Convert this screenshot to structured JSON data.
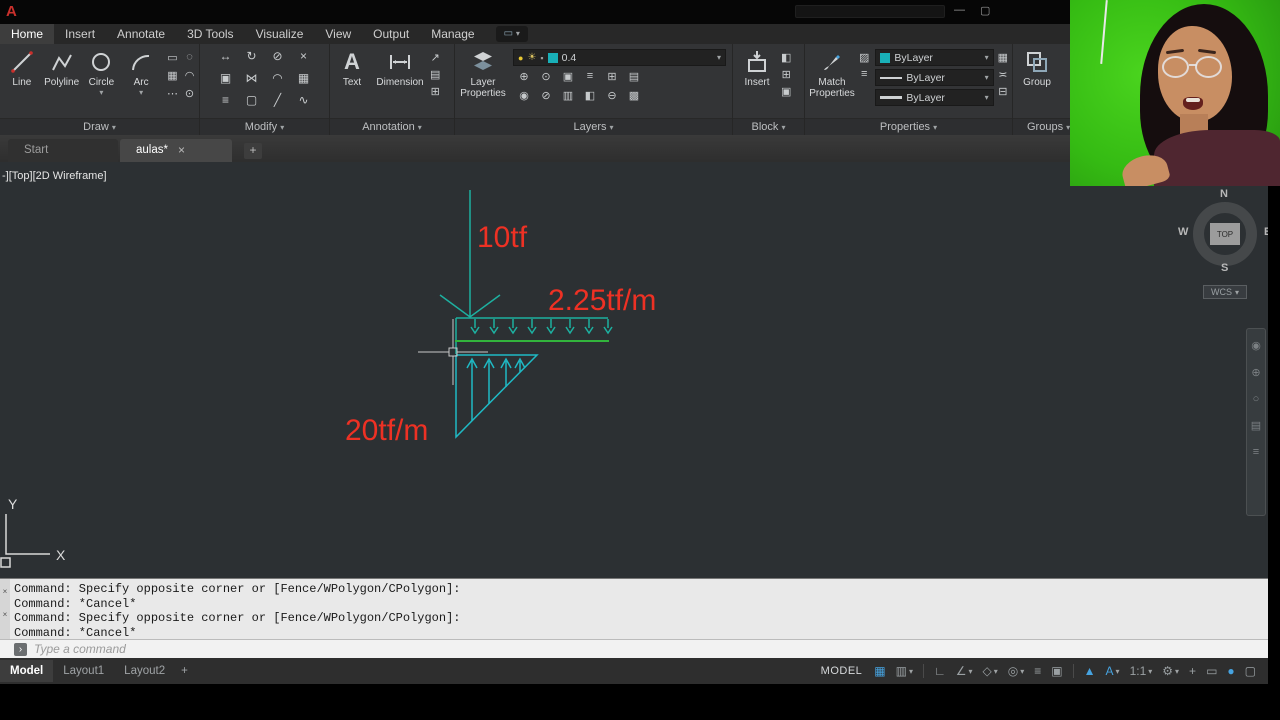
{
  "colors": {
    "accent_blue": "#46a3e0",
    "annotation_red": "#ee3124",
    "beam_green": "#32b43c",
    "load_teal": "#1db0a0",
    "triangle_cyan": "#1fb9c4",
    "chroma_green": "#35bb13"
  },
  "glyphs": {
    "caret": "▾",
    "close": "×",
    "plus": "+",
    "share": "▭",
    "prompt": "›"
  },
  "titlebar": {
    "app_initial": "A",
    "minimize": "—",
    "maximize": "▢"
  },
  "ribbon": {
    "tabs": [
      {
        "label": "Home"
      },
      {
        "label": "Insert"
      },
      {
        "label": "Annotate"
      },
      {
        "label": "3D Tools"
      },
      {
        "label": "Visualize"
      },
      {
        "label": "View"
      },
      {
        "label": "Output"
      },
      {
        "label": "Manage"
      }
    ],
    "draw": {
      "label": "Draw",
      "tools": [
        {
          "label": "Line"
        },
        {
          "label": "Polyline"
        },
        {
          "label": "Circle"
        },
        {
          "label": "Arc"
        }
      ],
      "small_icons": [
        "▭",
        "◌",
        "▦",
        "◠",
        "⋯",
        "⊙"
      ]
    },
    "modify": {
      "label": "Modify",
      "icons": [
        "↔",
        "↻",
        "⊘",
        "×",
        "▣",
        "⋈",
        "◠",
        "▦",
        "≡",
        "▢",
        "╱",
        "∿"
      ]
    },
    "annotation": {
      "label": "Annotation",
      "text_glyph": "A",
      "tools": [
        {
          "label": "Text"
        },
        {
          "label": "Dimension"
        }
      ],
      "small_icons": [
        "↗",
        "▤",
        "⊞"
      ]
    },
    "layers": {
      "label": "Layers",
      "big_label": "Layer Properties",
      "bulb": "●",
      "sun": "☀",
      "lock": "▪",
      "layer_value": "0.4",
      "small_icons": [
        "⊕",
        "⊙",
        "▣",
        "≡",
        "⊞",
        "▤",
        "◉",
        "⊘",
        "▥",
        "◧",
        "⊖",
        "▩"
      ]
    },
    "block": {
      "label": "Block",
      "big_label": "Insert",
      "small_icons": [
        "◧",
        "⊞",
        "▣"
      ]
    },
    "properties": {
      "label": "Properties",
      "big_label": "Match Properties",
      "left_icons": [
        "▨",
        "≡"
      ],
      "dropdowns": [
        {
          "value": "ByLayer"
        },
        {
          "value": "ByLayer"
        },
        {
          "value": "ByLayer"
        }
      ],
      "right_icons": [
        "▦",
        "≍",
        "⊟"
      ]
    },
    "groups": {
      "label": "Groups",
      "big_label": "Group"
    }
  },
  "file_tabs": {
    "tabs": [
      {
        "label": "Start"
      },
      {
        "label": "aulas*"
      }
    ]
  },
  "canvas": {
    "viewport_label": "-][Top][2D Wireframe]",
    "labels": {
      "point_load": "10tf",
      "udl": "2.25tf/m",
      "triangular_load": "20tf/m"
    },
    "ucs": {
      "x": "X",
      "y": "Y"
    }
  },
  "viewcube": {
    "north": "N",
    "south": "S",
    "east": "E",
    "west": "W",
    "face": "TOP",
    "wcs": "WCS"
  },
  "navbar": {
    "icons": [
      "◉",
      "⊕",
      "○",
      "▤",
      "≡"
    ]
  },
  "command": {
    "history": [
      "Command: Specify opposite corner or [Fence/WPolygon/CPolygon]:",
      "Command: *Cancel*",
      "Command: Specify opposite corner or [Fence/WPolygon/CPolygon]:",
      "Command: *Cancel*"
    ],
    "prompt_icon": "›",
    "placeholder": "Type a command"
  },
  "statusbar": {
    "layout_tabs": [
      {
        "label": "Model"
      },
      {
        "label": "Layout1"
      },
      {
        "label": "Layout2"
      }
    ],
    "add_layout": "+",
    "model_badge": "MODEL",
    "icons": [
      {
        "name": "grid",
        "glyph": "▦"
      },
      {
        "name": "snap",
        "glyph": "▥"
      },
      {
        "name": "ortho",
        "glyph": "∟"
      },
      {
        "name": "polar",
        "glyph": "∠"
      },
      {
        "name": "isodraft",
        "glyph": "◇"
      },
      {
        "name": "osnap",
        "glyph": "◎"
      },
      {
        "name": "lineweight",
        "glyph": "≡"
      },
      {
        "name": "selection-cycling",
        "glyph": "▣"
      },
      {
        "name": "annotation-visibility",
        "glyph": "▲"
      },
      {
        "name": "autoscale",
        "glyph": "A"
      },
      {
        "name": "annotation-scale",
        "glyph": "1:1"
      },
      {
        "name": "workspace",
        "glyph": "⚙"
      },
      {
        "name": "plus",
        "glyph": "+"
      },
      {
        "name": "isolate",
        "glyph": "▭"
      },
      {
        "name": "graphics",
        "glyph": "●"
      },
      {
        "name": "clean-screen",
        "glyph": "▢"
      }
    ]
  }
}
